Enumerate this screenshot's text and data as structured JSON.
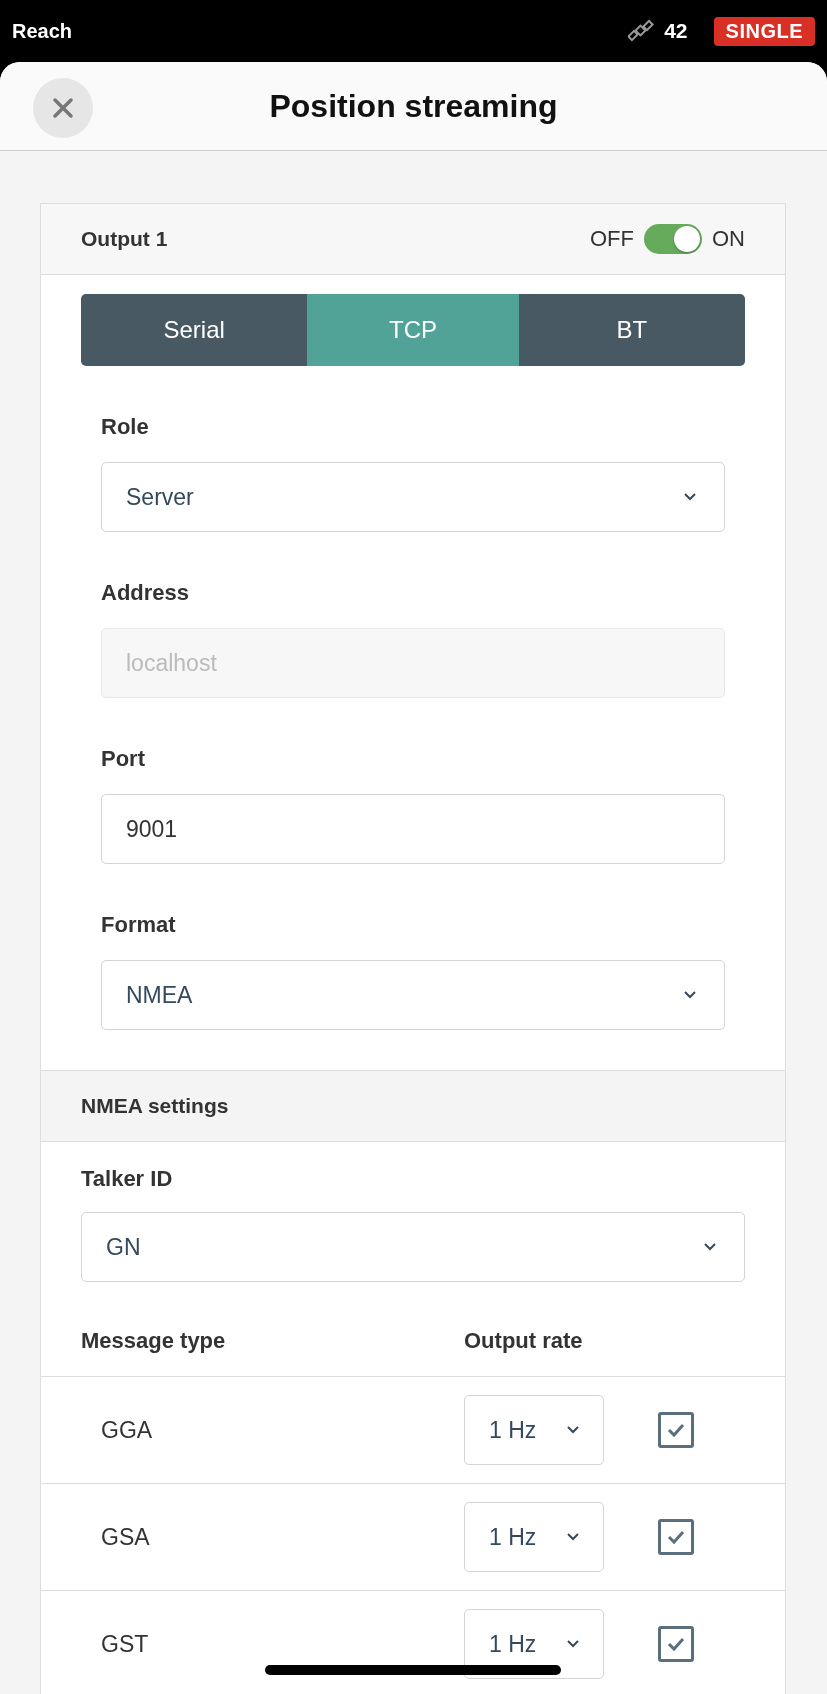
{
  "status_bar": {
    "app_name": "Reach",
    "satellites": "42",
    "solution": "SINGLE"
  },
  "header": {
    "title": "Position streaming"
  },
  "output": {
    "title": "Output 1",
    "toggle_off_label": "OFF",
    "toggle_on_label": "ON",
    "on": true,
    "tabs": [
      {
        "label": "Serial",
        "selected": false
      },
      {
        "label": "TCP",
        "selected": true
      },
      {
        "label": "BT",
        "selected": false
      }
    ],
    "fields": [
      {
        "kind": "select",
        "label": "Role",
        "value": "Server"
      },
      {
        "kind": "input",
        "label": "Address",
        "placeholder": "localhost",
        "disabled": true
      },
      {
        "kind": "input",
        "label": "Port",
        "value": "9001",
        "disabled": false
      },
      {
        "kind": "select",
        "label": "Format",
        "value": "NMEA"
      }
    ]
  },
  "nmea": {
    "title": "NMEA settings",
    "talker_label": "Talker ID",
    "talker_value": "GN",
    "columns": [
      "Message type",
      "Output rate"
    ],
    "rows": [
      {
        "type": "GGA",
        "rate": "1 Hz",
        "checked": true
      },
      {
        "type": "GSA",
        "rate": "1 Hz",
        "checked": true
      },
      {
        "type": "GST",
        "rate": "1 Hz",
        "checked": true
      }
    ]
  }
}
